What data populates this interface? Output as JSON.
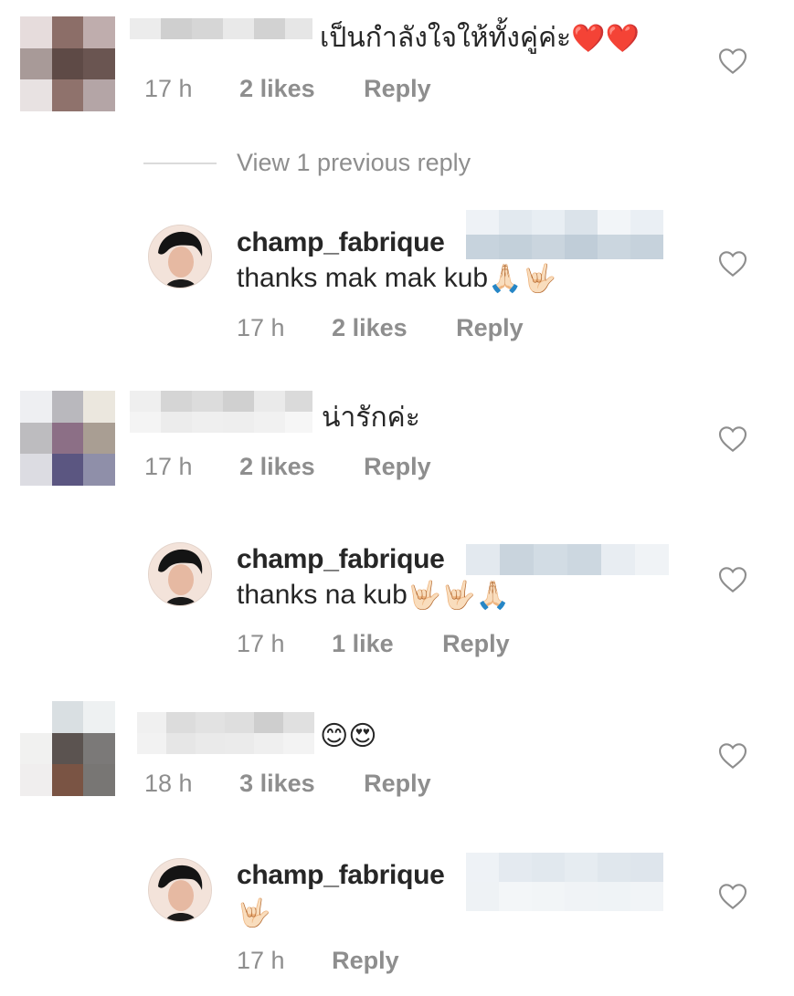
{
  "comments": [
    {
      "type": "comment",
      "text": "เป็นกำลังใจให้ทั้งคู่ค่ะ",
      "emoji": [
        "❤️",
        "❤️"
      ],
      "time": "17 h",
      "likes": "2 likes",
      "reply": "Reply"
    },
    {
      "type": "view_replies",
      "text": "View 1 previous reply"
    },
    {
      "type": "reply",
      "username": "champ_fabrique",
      "text": "thanks mak mak kub",
      "emoji": [
        "🙏🏻",
        "🤟🏻"
      ],
      "time": "17 h",
      "likes": "2 likes",
      "reply": "Reply"
    },
    {
      "type": "comment",
      "text": "น่ารักค่ะ",
      "emoji": [],
      "time": "17 h",
      "likes": "2 likes",
      "reply": "Reply"
    },
    {
      "type": "reply",
      "username": "champ_fabrique",
      "text": "thanks na kub",
      "emoji": [
        "🤟🏻",
        "🤟🏻",
        "🙏🏻"
      ],
      "time": "17 h",
      "likes": "1 like",
      "reply": "Reply"
    },
    {
      "type": "comment",
      "text": "",
      "emoji": [
        "😊",
        "😍"
      ],
      "time": "18 h",
      "likes": "3 likes",
      "reply": "Reply"
    },
    {
      "type": "reply",
      "username": "champ_fabrique",
      "text": "",
      "emoji": [
        "🤟🏻"
      ],
      "time": "17 h",
      "likes": "",
      "reply": "Reply"
    }
  ],
  "colors": {
    "text": "#262626",
    "meta": "#8e8e8e",
    "divider": "#dbdbdb",
    "heart_outline": "#8e8e8e"
  },
  "icons": {
    "like": "heart-outline-icon"
  }
}
